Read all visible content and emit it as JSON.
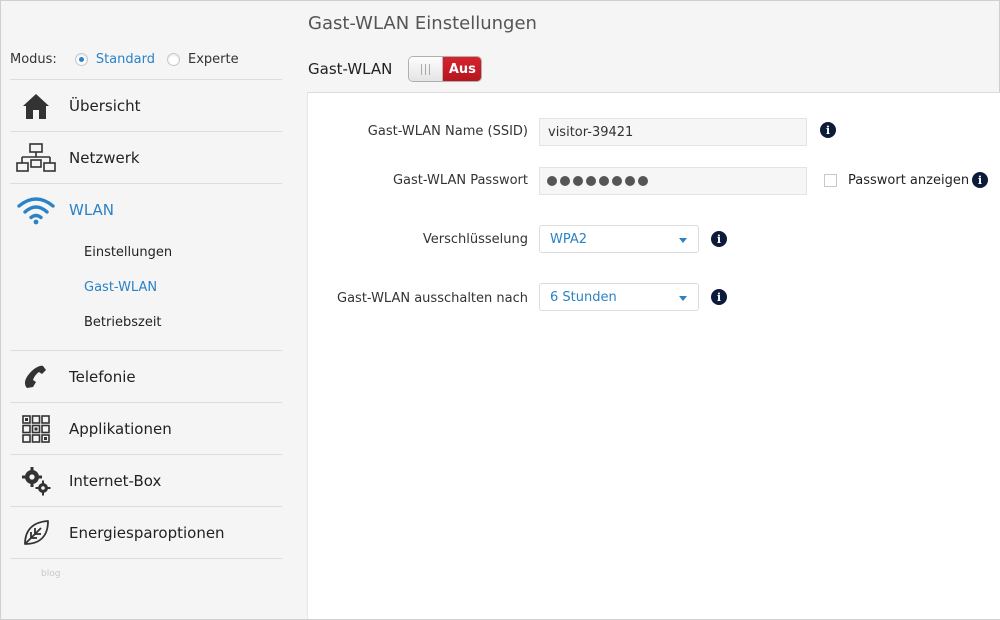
{
  "page": {
    "title": "Gast-WLAN Einstellungen"
  },
  "mode": {
    "label": "Modus:",
    "options": [
      {
        "label": "Standard",
        "selected": true
      },
      {
        "label": "Experte",
        "selected": false
      }
    ]
  },
  "nav": {
    "items": [
      {
        "label": "Übersicht",
        "icon": "house-icon"
      },
      {
        "label": "Netzwerk",
        "icon": "network-icon"
      },
      {
        "label": "WLAN",
        "icon": "wifi-icon",
        "active": true
      },
      {
        "label": "Telefonie",
        "icon": "phone-icon"
      },
      {
        "label": "Applikationen",
        "icon": "apps-grid-icon"
      },
      {
        "label": "Internet-Box",
        "icon": "gears-icon"
      },
      {
        "label": "Energiesparoptionen",
        "icon": "leaf-icon"
      }
    ],
    "wlan_sub": [
      {
        "label": "Einstellungen"
      },
      {
        "label": "Gast-WLAN",
        "active": true
      },
      {
        "label": "Betriebszeit"
      }
    ],
    "footnote": "blog"
  },
  "guest": {
    "toggle_label": "Gast-WLAN",
    "toggle_state": "Aus"
  },
  "form": {
    "ssid_label": "Gast-WLAN Name (SSID)",
    "ssid_value": "visitor-39421",
    "password_label": "Gast-WLAN Passwort",
    "show_password_label": "Passwort anzeigen",
    "encryption_label": "Verschlüsselung",
    "encryption_value": "WPA2",
    "timeout_label": "Gast-WLAN ausschalten nach",
    "timeout_value": "6 Stunden",
    "info_glyph": "i"
  },
  "colors": {
    "accent": "#2a82c7",
    "toggle_off": "#c81e28",
    "info_bg": "#0d1b3a"
  }
}
